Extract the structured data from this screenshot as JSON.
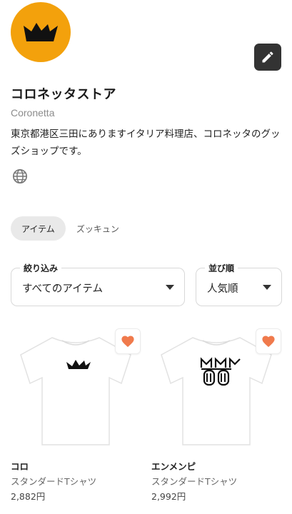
{
  "shop": {
    "name": "コロネッタストア",
    "subname": "Coronetta",
    "description": "東京都港区三田にありますイタリア料理店、コロネッタのグッズショップです。",
    "avatar_color": "#f3a10c"
  },
  "icons": {
    "edit": "pencil-icon",
    "website": "globe-icon",
    "favorite": "heart-icon",
    "dropdown": "caret-down-icon"
  },
  "tabs": [
    {
      "label": "アイテム",
      "active": true
    },
    {
      "label": "ズッキュン",
      "active": false
    }
  ],
  "filters": {
    "filter": {
      "label": "絞り込み",
      "value": "すべてのアイテム"
    },
    "sort": {
      "label": "並び順",
      "value": "人気順"
    }
  },
  "products": [
    {
      "title": "コロ",
      "type": "スタンダードTシャツ",
      "price": "2,882円"
    },
    {
      "title": "エンメンピ",
      "type": "スタンダードTシャツ",
      "price": "2,992円"
    }
  ],
  "colors": {
    "heart": "#f07a4c",
    "accent": "#f3a10c"
  }
}
